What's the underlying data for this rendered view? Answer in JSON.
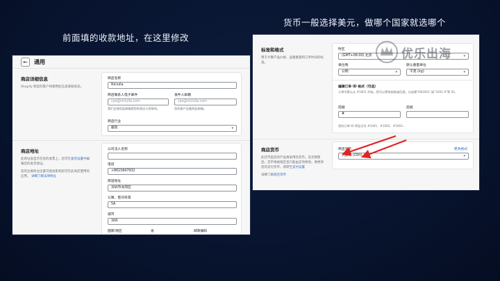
{
  "captions": {
    "left": "前面填的收款地址，在这里修改",
    "right": "货币一般选择美元，做哪个国家就选哪个"
  },
  "watermark": {
    "text": "优乐出海",
    "icon": "crown-logo-icon"
  },
  "left_panel": {
    "back_icon": "←",
    "title": "通用",
    "store_details": {
      "section_title": "商店详细信息",
      "section_desc": "Shopify 和您的客户将使用此信息来联系您。",
      "fields": {
        "store_name": {
          "label": "商店名称",
          "value": "Niclulla"
        },
        "account_email": {
          "label": "商店联系人电子邮件",
          "value": "cps@niclulla.com",
          "help": "我们会使用此邮箱就您的商店与您联系。"
        },
        "sender_email": {
          "label": "发件人邮箱",
          "value": "cps@niclulla.com",
          "help": "您的客户会看到此邮箱。"
        },
        "industry": {
          "label": "商店行业",
          "value": "服装"
        }
      }
    },
    "store_address": {
      "section_title": "商店地址",
      "section_desc": "此地址会显示在您的发票上，您可在",
      "section_link": "发货设置",
      "section_desc2": "中编辑您的发货地址。",
      "section_desc3": "您的主要商业位置可能会影响您可在此商店使用的应用。",
      "section_link2": "详细了解法律地址",
      "fields": {
        "legal_name": {
          "label": "公司法人名称",
          "value": ""
        },
        "phone": {
          "label": "电话",
          "value": "+8615847932"
        },
        "street": {
          "label": "街道地址",
          "value": "深圳市龙岗区"
        },
        "apartment": {
          "label": "公寓、套间号等",
          "value": "5A"
        },
        "city": {
          "label": "城市",
          "value": "深圳"
        },
        "country": {
          "label": "国家/地区",
          "value": ""
        },
        "province": {
          "label": "省",
          "value": ""
        },
        "postal": {
          "label": "邮政编码",
          "value": ""
        }
      }
    }
  },
  "right_panel": {
    "standards": {
      "section_title": "标准和格式",
      "section_desc": "用于计算产品价格、运输重量和订单时间的标准。",
      "timezone": {
        "label": "时区",
        "value": "(GMT+08:00) 北京"
      },
      "unit_system": {
        "label": "单位制",
        "value": "公制"
      },
      "weight_unit": {
        "label": "默认重量单位",
        "value": "千克 (kg)"
      },
      "order_id_title": "编辑订单 ID 格式（可选）",
      "order_id_desc": "订单号默认从 #1001 开始。您可以更改前缀或后缀，以创建“EN1001”或“1001-A”等 ID。",
      "prefix": {
        "label": "前缀",
        "value": "#"
      },
      "suffix": {
        "label": "后缀",
        "value": ""
      },
      "order_id_preview": "您的订单 ID 将显示为 #1001、#1002、#1003..."
    },
    "currency": {
      "section_title": "商店货币",
      "section_desc": "此货币是您的产品将采用的货币。首次销售后，货币将被锁定且只能由支持更改。要更改您的支付货币，请转至",
      "section_link": "支付设置",
      "learn_more_prefix": "详细了解",
      "learn_more_link": "商店货币",
      "field_label": "商店货币",
      "field_value": "人民币 (CNY)",
      "change_link": "更改格式"
    }
  },
  "colors": {
    "arrow": "#e02424",
    "link": "#2c6ecb",
    "background": "#081430"
  }
}
